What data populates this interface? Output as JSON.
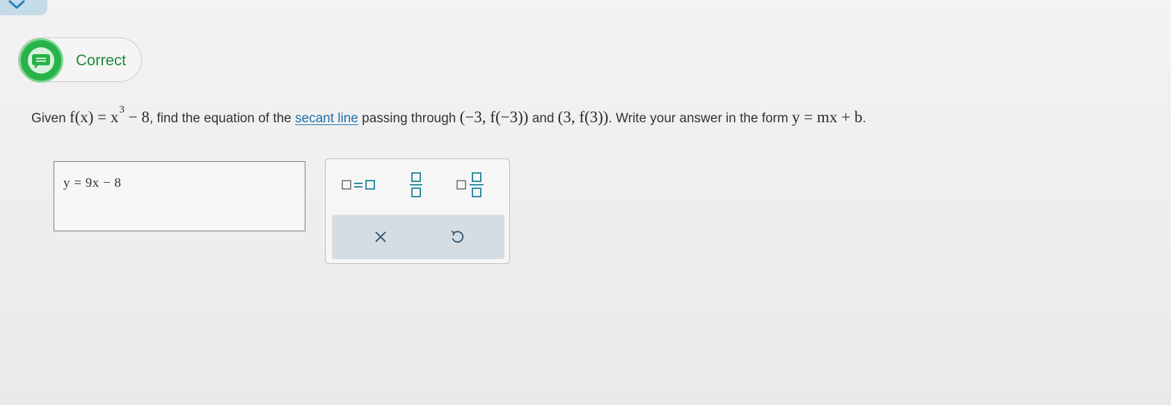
{
  "colors": {
    "correct_green": "#27b34a",
    "link_blue": "#1f6fa8",
    "teal_icon": "#2a8ca0"
  },
  "status": {
    "label": "Correct",
    "icon": "chat-check-icon"
  },
  "question": {
    "prefix": "Given",
    "fx": "f(x) = x",
    "exponent": "3",
    "minus": "− 8",
    "text1": ", find the equation of the",
    "link": "secant line",
    "text2": "passing through",
    "point1": "(−3, f(−3))",
    "and": "and",
    "point2": "(3, f(3))",
    "text3": ". Write your answer in the form",
    "form": "y = mx + b",
    "end": "."
  },
  "answer": {
    "value": "y = 9x − 8"
  },
  "keypad": {
    "keys": [
      "equals-template",
      "fraction-template",
      "mixed-number-template"
    ],
    "clear_icon": "close-icon",
    "undo_icon": "undo-icon"
  }
}
